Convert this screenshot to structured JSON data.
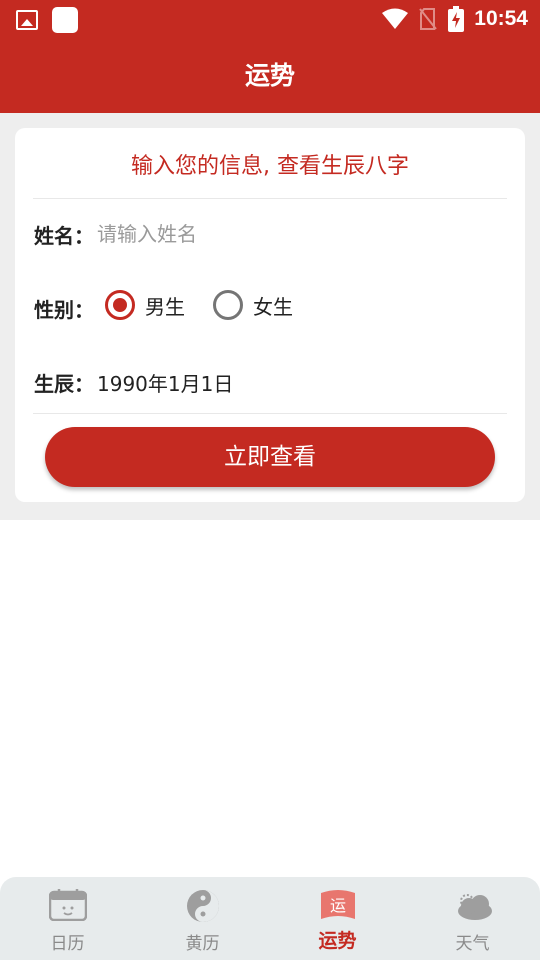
{
  "status_bar": {
    "time": "10:54"
  },
  "app_bar": {
    "title": "运势"
  },
  "form": {
    "heading": "输入您的信息, 查看生辰八字",
    "name_label": "姓名：",
    "name_placeholder": "请输入姓名",
    "name_value": "",
    "gender_label": "性别：",
    "gender_options": [
      {
        "label": "男生",
        "selected": true
      },
      {
        "label": "女生",
        "selected": false
      }
    ],
    "birth_label": "生辰：",
    "birth_value": "1990年1月1日",
    "submit_label": "立即查看"
  },
  "tabs": [
    {
      "label": "日历",
      "icon": "calendar-icon",
      "active": false
    },
    {
      "label": "黄历",
      "icon": "yin-yang-icon",
      "active": false
    },
    {
      "label": "运势",
      "icon": "fortune-flag-icon",
      "active": true,
      "icon_text": "运"
    },
    {
      "label": "天气",
      "icon": "weather-cloud-icon",
      "active": false
    }
  ],
  "colors": {
    "primary": "#c42a21",
    "tab_inactive": "#8a8a8a",
    "tabbar_bg": "#e7ebec",
    "page_bg": "#eeeeee"
  }
}
